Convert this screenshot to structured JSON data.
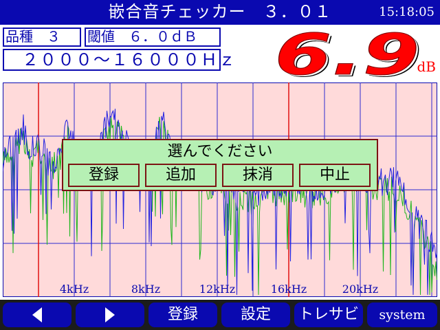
{
  "header": {
    "title": "嵌合音チェッカー　３．０１",
    "clock": "15:18:05"
  },
  "info": {
    "product_type": "品種　３",
    "threshold": "閾値　６．０ｄＢ",
    "freq_range": "２０００〜１６０００Ｈｚ"
  },
  "measurement": {
    "value": "6.9",
    "unit": "dB"
  },
  "chart_data": {
    "type": "line",
    "x_tick_labels": [
      "4kHz",
      "8kHz",
      "12kHz",
      "16kHz",
      "20kHz"
    ],
    "series": [
      {
        "name": "",
        "color": "#1f1fe0"
      },
      {
        "name": "",
        "color": "#1db51d"
      }
    ],
    "range_markers_khz": [
      2,
      16
    ],
    "grid": true,
    "background": "#ffdada"
  },
  "dialog": {
    "prompt": "選んでください",
    "buttons": [
      "登録",
      "追加",
      "抹消",
      "中止"
    ]
  },
  "footer": {
    "buttons": [
      {
        "label": "",
        "icon": "left-arrow-icon"
      },
      {
        "label": "",
        "icon": "right-arrow-icon"
      },
      {
        "label": "登録"
      },
      {
        "label": "設定"
      },
      {
        "label": "トレサビ"
      },
      {
        "label": "system"
      }
    ]
  },
  "colors": {
    "accent": "#0a09b0",
    "alert": "#ff0000",
    "dialog_bg": "#b6f0b4",
    "dialog_border": "#7b1313"
  }
}
